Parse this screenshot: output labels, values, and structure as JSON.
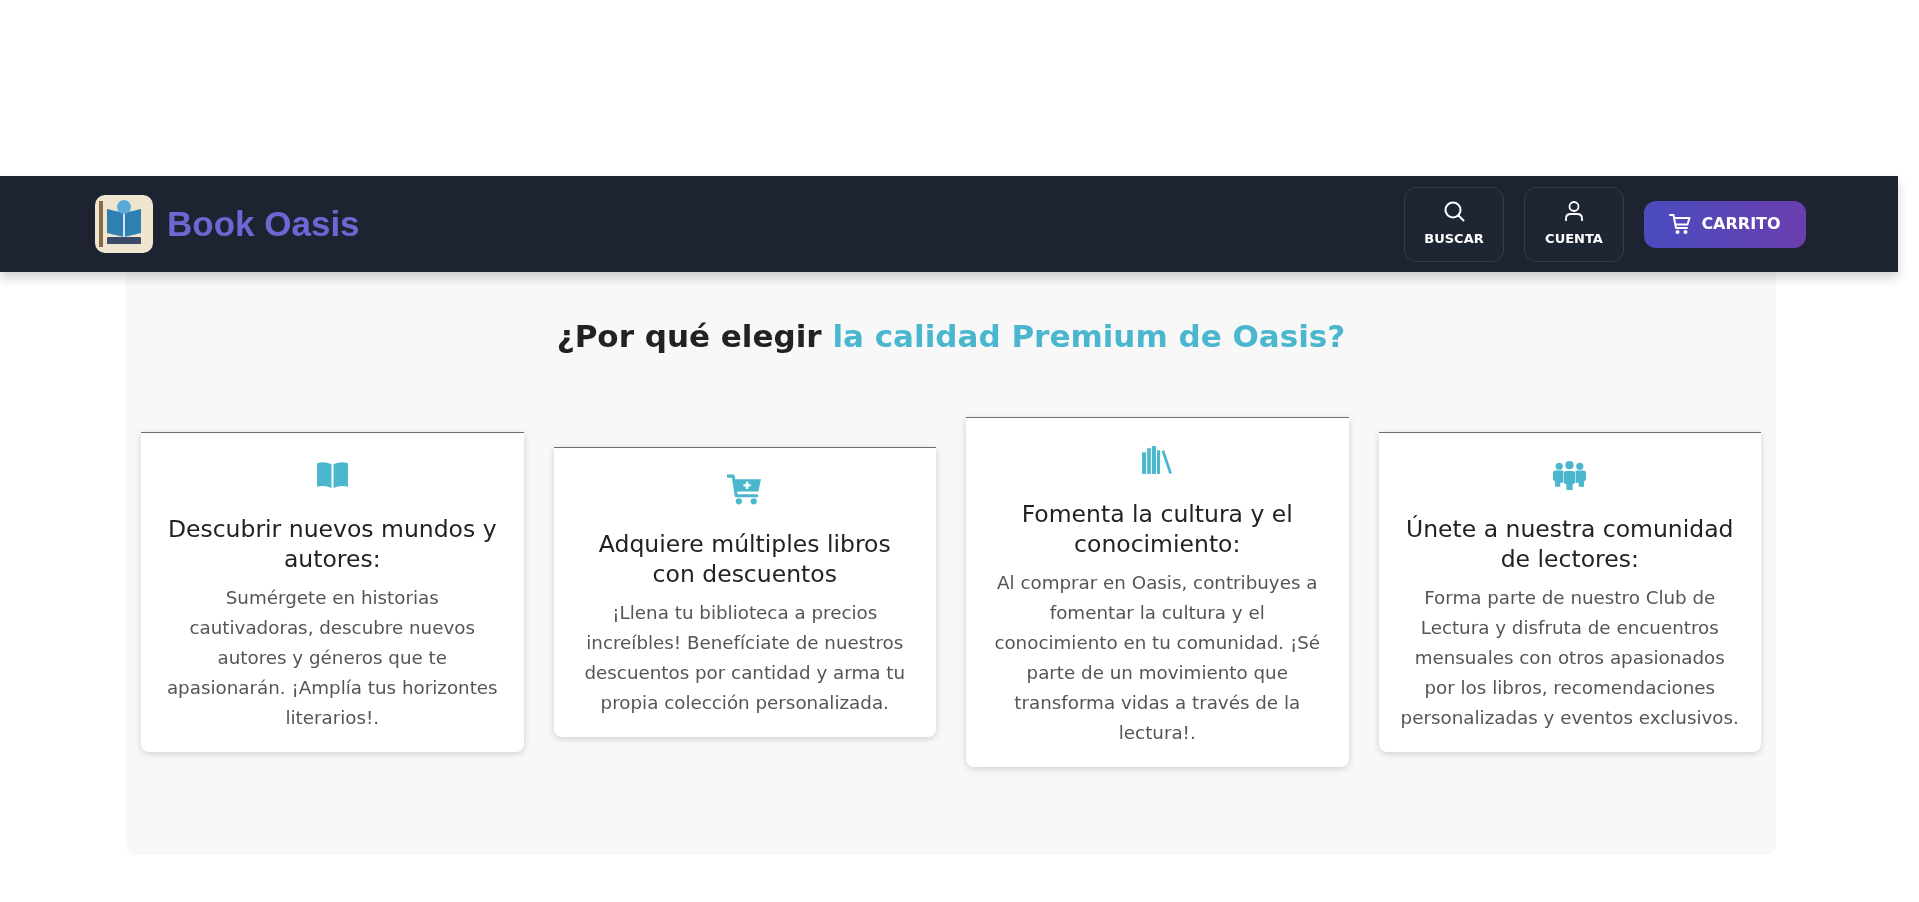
{
  "navbar": {
    "brand": "Book Oasis",
    "buttons": [
      {
        "label": "BUSCAR",
        "kind": "tile"
      },
      {
        "label": "CUENTA",
        "kind": "tile"
      },
      {
        "label": "CARRITO",
        "kind": "primary"
      }
    ]
  },
  "section": {
    "heading": "¿Por qué elegir",
    "heading_highlight": "la calidad Premium de Oasis?",
    "features": [
      {
        "title": "Descubrir nuevos mundos y autores:",
        "text": "Sumérgete en historias cautivadoras, descubre nuevos autores y géneros que te apasionarán. ¡Amplía tus horizontes literarios!."
      },
      {
        "title": "Adquiere múltiples libros con descuentos",
        "text": "¡Llena tu biblioteca a precios increíbles! Benefíciate de nuestros descuentos por cantidad y arma tu propia colección personalizada."
      },
      {
        "title": "Fomenta la cultura y el conocimiento:",
        "text": "Al comprar en Oasis, contribuyes a fomentar la cultura y el conocimiento en tu comunidad. ¡Sé parte de un movimiento que transforma vidas a través de la lectura!."
      },
      {
        "title": "Únete a nuestra comunidad de lectores:",
        "text": "Forma parte de nuestro Club de Lectura y disfruta de encuentros mensuales con otros apasionados por los libros, recomendaciones personalizadas y eventos exclusivos."
      }
    ]
  }
}
